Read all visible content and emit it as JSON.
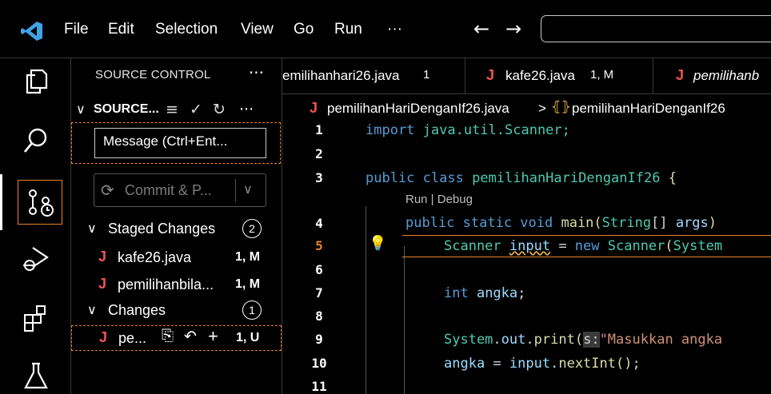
{
  "titlebar": {
    "menu": [
      "File",
      "Edit",
      "Selection",
      "View",
      "Go",
      "Run",
      "···"
    ],
    "back_arrow": "←",
    "forward_arrow": "→"
  },
  "activity": {
    "icons": [
      "explorer-icon",
      "search-icon",
      "source-control-icon",
      "run-debug-icon",
      "extensions-icon",
      "testing-icon"
    ]
  },
  "sidebar": {
    "title": "SOURCE CONTROL",
    "more": "···",
    "section_label": "SOURCE...",
    "message_placeholder": "Message (Ctrl+Ent...",
    "commit_label": "Commit & P...",
    "staged": {
      "label": "Staged Changes",
      "count": "2"
    },
    "staged_files": [
      {
        "icon": "J",
        "name": "kafe26.java",
        "status": "1, M"
      },
      {
        "icon": "J",
        "name": "pemilihanbila...",
        "status": "1, M"
      }
    ],
    "changes": {
      "label": "Changes",
      "count": "1"
    },
    "change_files": [
      {
        "icon": "J",
        "name": "pe...",
        "status": "1, U"
      }
    ]
  },
  "tabs": [
    {
      "name": "emilihanhari26.java",
      "badge": "1"
    },
    {
      "icon": "J",
      "name": "kafe26.java",
      "badge": "1, M"
    },
    {
      "icon": "J",
      "name": "pemilihanb"
    }
  ],
  "breadcrumb": {
    "icon": "J",
    "file": "pemilihanHariDenganIf26.java",
    "sep": ">",
    "symbol": "pemilihanHariDenganIf26"
  },
  "editor": {
    "line_numbers": [
      "1",
      "2",
      "3",
      "4",
      "5",
      "6",
      "7",
      "8",
      "9",
      "10",
      "11"
    ],
    "codelens": "Run | Debug",
    "lines": {
      "l1": [
        "import",
        " java.util.Scanner;"
      ],
      "l3": [
        "public class ",
        "pemilihanHariDenganIf26",
        " {"
      ],
      "l4": [
        "public static void ",
        "main",
        "(",
        "String",
        "[] ",
        "args",
        ")"
      ],
      "l5": [
        "Scanner ",
        "input",
        " = ",
        "new ",
        "Scanner",
        "(",
        "System"
      ],
      "l7": [
        "int ",
        "angka",
        ";"
      ],
      "l9": [
        "System",
        ".",
        "out",
        ".",
        "print",
        "(",
        "s:",
        "\"Masukkan angka"
      ],
      "l10": [
        "angka",
        " = ",
        "input",
        ".",
        "nextInt",
        "();"
      ]
    }
  },
  "colors": {
    "accent_orange": "#e8832a",
    "keyword": "#569cd6",
    "type": "#4ec9b0",
    "function": "#dcdcaa",
    "variable": "#9cdcfe",
    "string": "#ce9178",
    "java_icon": "#f05454",
    "vscode_logo": "#3fa3e6"
  }
}
